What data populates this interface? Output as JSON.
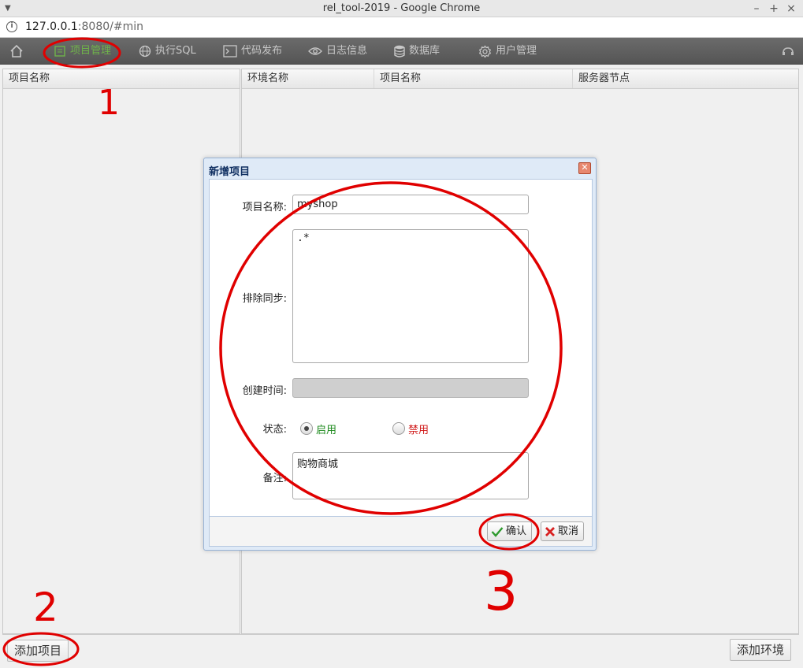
{
  "window": {
    "title": "rel_tool-2019 - Google Chrome",
    "minimize": "–",
    "maximize": "+",
    "close": "×"
  },
  "browser": {
    "url_host": "127.0.0.1",
    "url_rest": ":8080/#min"
  },
  "nav": {
    "items": [
      {
        "label": "",
        "icon": "home-icon"
      },
      {
        "label": "项目管理",
        "icon": "project-icon",
        "active": true
      },
      {
        "label": "执行SQL",
        "icon": "globe-icon"
      },
      {
        "label": "代码发布",
        "icon": "terminal-icon"
      },
      {
        "label": "日志信息",
        "icon": "eye-icon"
      },
      {
        "label": "数据库",
        "icon": "database-icon"
      },
      {
        "label": "用户管理",
        "icon": "gear-icon"
      }
    ]
  },
  "left_panel": {
    "columns": [
      "项目名称"
    ]
  },
  "right_panel": {
    "columns": [
      "环境名称",
      "项目名称",
      "服务器节点"
    ]
  },
  "buttons": {
    "add_project": "添加项目",
    "add_env": "添加环境"
  },
  "dialog": {
    "title": "新增项目",
    "fields": {
      "name_label": "项目名称:",
      "name_value": "myshop",
      "exclude_label": "排除同步:",
      "exclude_value": ".*",
      "created_label": "创建时间:",
      "created_value": "",
      "status_label": "状态:",
      "status_enabled": "启用",
      "status_disabled": "禁用",
      "remark_label": "备注:",
      "remark_value": "购物商城"
    },
    "confirm": "确认",
    "cancel": "取消"
  },
  "annotations": {
    "step1": "1",
    "step2": "2",
    "step3": "3"
  },
  "colors": {
    "nav_bg": "#5e5e5e",
    "nav_active": "#6fb34a",
    "enabled_green": "#1d8a1d",
    "disabled_red": "#d01818",
    "annotation_red": "#e00000"
  }
}
